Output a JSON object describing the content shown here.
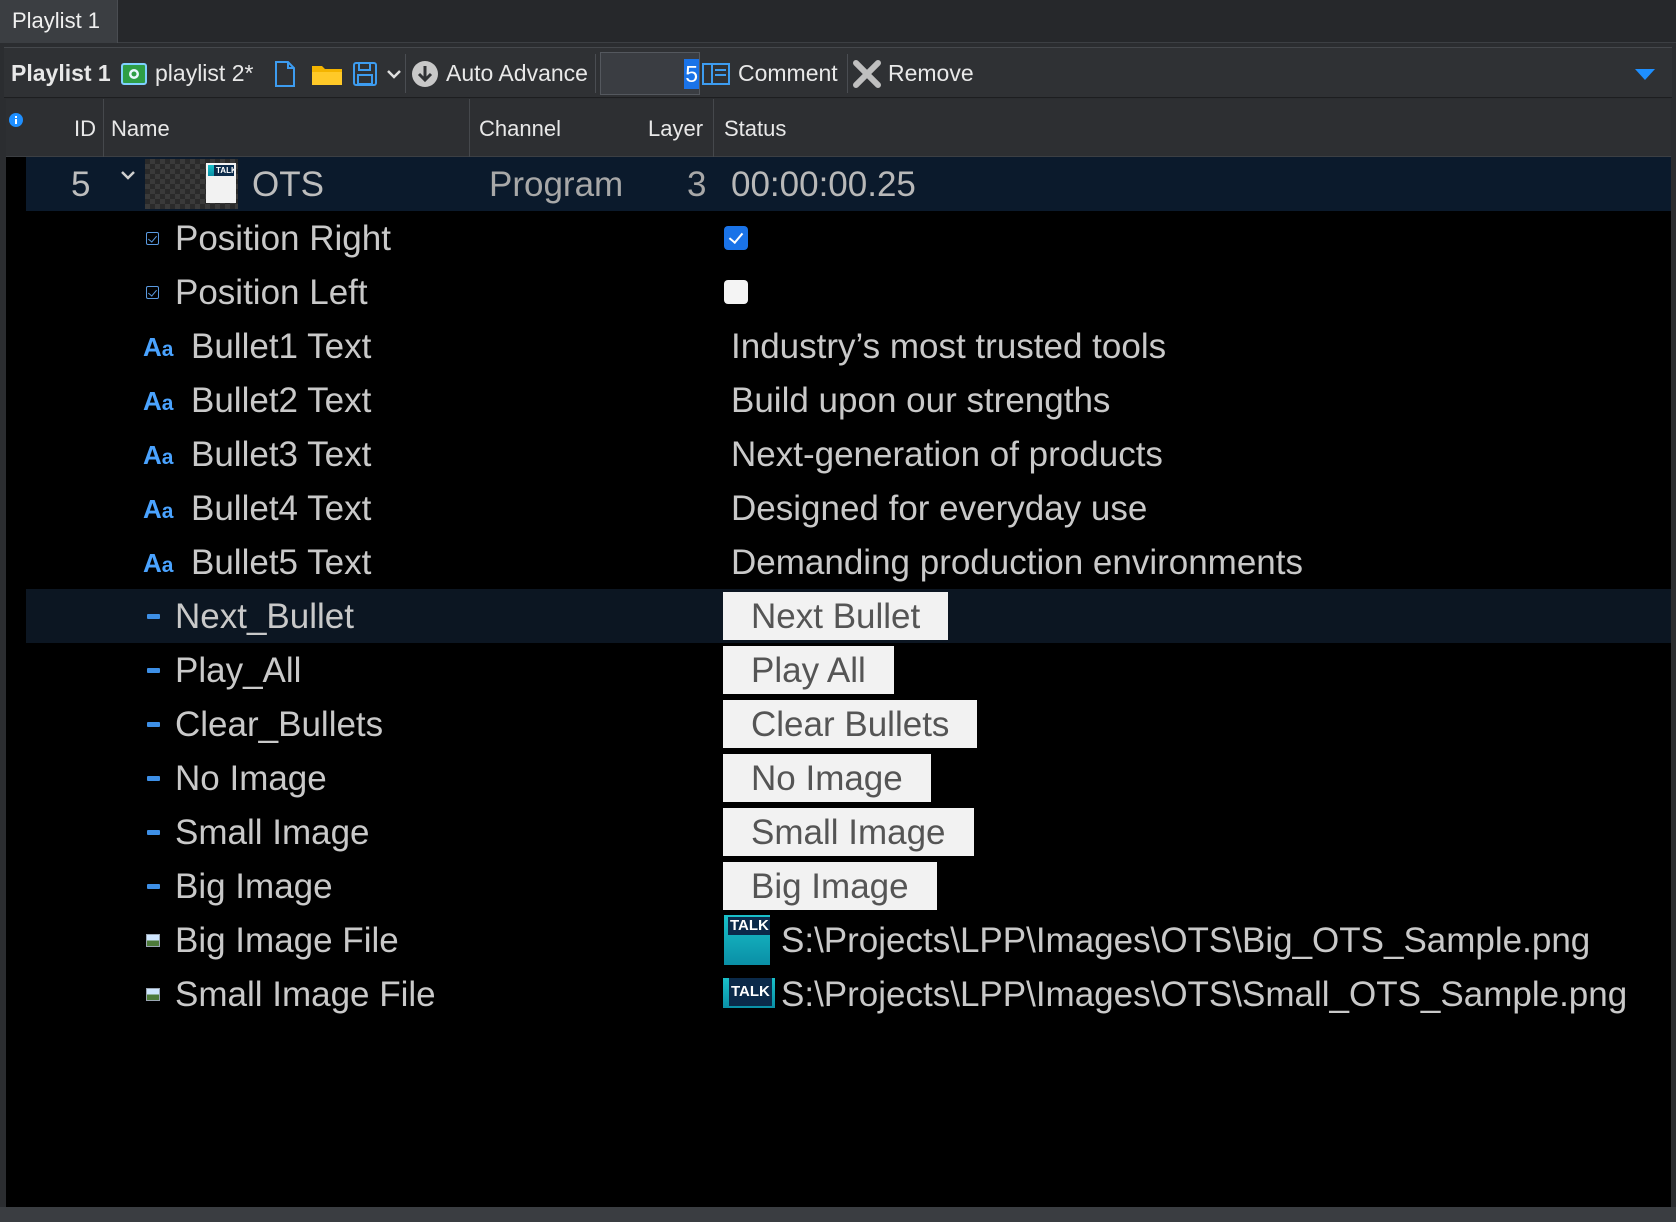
{
  "tab": {
    "label": "Playlist 1"
  },
  "toolbar": {
    "playlist_label": "Playlist 1",
    "playlist_name": "playlist 2*",
    "auto_advance": "Auto Advance",
    "counter_value": "5",
    "comment": "Comment",
    "remove": "Remove"
  },
  "columns": {
    "id": "ID",
    "name": "Name",
    "channel": "Channel",
    "layer": "Layer",
    "status": "Status"
  },
  "item": {
    "id": "5",
    "name": "OTS",
    "channel": "Program",
    "layer": "3",
    "status": "00:00:00.25",
    "thumb_text": "TALK"
  },
  "fields": {
    "position_right": {
      "label": "Position Right",
      "checked": true
    },
    "position_left": {
      "label": "Position Left",
      "checked": false
    },
    "bullet1": {
      "label": "Bullet1 Text",
      "value": "Industry’s most trusted tools"
    },
    "bullet2": {
      "label": "Bullet2 Text",
      "value": "Build upon our strengths"
    },
    "bullet3": {
      "label": "Bullet3 Text",
      "value": "Next-generation of products"
    },
    "bullet4": {
      "label": "Bullet4 Text",
      "value": "Designed for everyday use"
    },
    "bullet5": {
      "label": "Bullet5 Text",
      "value": "Demanding production environments"
    },
    "next_bullet": {
      "label": "Next_Bullet",
      "button": "Next Bullet"
    },
    "play_all": {
      "label": "Play_All",
      "button": "Play All"
    },
    "clear_bullets": {
      "label": "Clear_Bullets",
      "button": "Clear Bullets"
    },
    "no_image": {
      "label": "No Image",
      "button": "No Image"
    },
    "small_image": {
      "label": "Small Image",
      "button": "Small Image"
    },
    "big_image": {
      "label": "Big Image",
      "button": "Big Image"
    },
    "big_image_file": {
      "label": "Big Image File",
      "value": "S:\\Projects\\LPP\\Images\\OTS\\Big_OTS_Sample.png"
    },
    "small_image_file": {
      "label": "Small Image File",
      "value": "S:\\Projects\\LPP\\Images\\OTS\\Small_OTS_Sample.png"
    }
  },
  "colors": {
    "accent": "#1a73e8",
    "selected_row": "#0b1a2c",
    "grid_bg": "#000000"
  }
}
